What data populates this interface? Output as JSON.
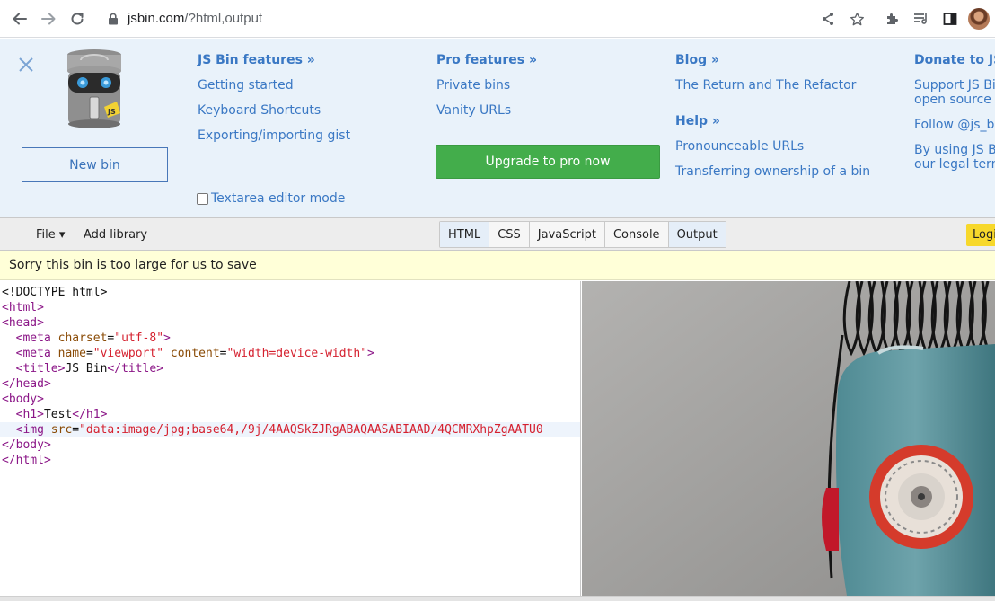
{
  "browser": {
    "url_host": "jsbin.com",
    "url_path": "/?html,output",
    "icons": [
      "back-icon",
      "forward-icon",
      "reload-icon",
      "lock-icon",
      "share-icon",
      "star-icon",
      "extensions-icon",
      "reading-list-icon",
      "side-panel-icon",
      "profile-avatar"
    ]
  },
  "panel": {
    "new_bin_label": "New bin",
    "logo_text": "JS",
    "textarea_mode_label": "Textarea editor mode",
    "textarea_mode_checked": false,
    "columns": {
      "features": {
        "heading": "JS Bin features »",
        "links": [
          "Getting started",
          "Keyboard Shortcuts",
          "Exporting/importing gist"
        ]
      },
      "pro": {
        "heading": "Pro features »",
        "links": [
          "Private bins",
          "Vanity URLs"
        ],
        "upgrade_label": "Upgrade to pro now"
      },
      "blog": {
        "heading": "Blog »",
        "links": [
          "The Return and The Refactor"
        ],
        "help_heading": "Help »",
        "help_links": [
          "Pronounceable URLs",
          "Transferring ownership of a bin"
        ]
      },
      "donate": {
        "heading": "Donate to JS",
        "links": [
          "Support JS Bin to keep the open source &",
          "Follow @js_bin",
          "By using JS Bin you agree to our legal terms"
        ]
      }
    }
  },
  "toolbar": {
    "file_label": "File ▾",
    "add_library_label": "Add library",
    "tabs": [
      "HTML",
      "CSS",
      "JavaScript",
      "Console",
      "Output"
    ],
    "active_tabs": [
      "HTML",
      "Output"
    ],
    "login_label": "Login"
  },
  "notice": {
    "text": "Sorry this bin is too large for us to save"
  },
  "editor": {
    "lines": {
      "l1": "<!DOCTYPE html>",
      "l2": "<html>",
      "l3": "<head>",
      "l4_tag": "<meta",
      "l4_attr": "charset",
      "l4_val": "\"utf-8\"",
      "l5_tag": "<meta",
      "l5_attr1": "name",
      "l5_val1": "\"viewport\"",
      "l5_attr2": "content",
      "l5_val2": "\"width=device-width\"",
      "l6_open": "<title>",
      "l6_text": "JS Bin",
      "l6_close": "</title>",
      "l7": "</head>",
      "l8": "<body>",
      "l9_open": "<h1>",
      "l9_text": "Test",
      "l9_close": "</h1>",
      "l10_tag": "<img",
      "l10_attr": "src",
      "l10_val": "\"data:image/jpg;base64,/9j/4AAQSkZJRgABAQAASABIAAD/4QCMRXhpZgAATU0",
      "l11": "</body>",
      "l12": "</html>"
    }
  },
  "output": {
    "image_description": "output-image-robot"
  },
  "colors": {
    "link": "#3a78c4",
    "panel_bg": "#e9f2fa",
    "upgrade_bg": "#43ad4b",
    "notice_bg": "#ffffd8",
    "login_bg": "#f7d82b",
    "tag": "#8b1687",
    "attr": "#8a4b06",
    "string": "#d5212f"
  }
}
